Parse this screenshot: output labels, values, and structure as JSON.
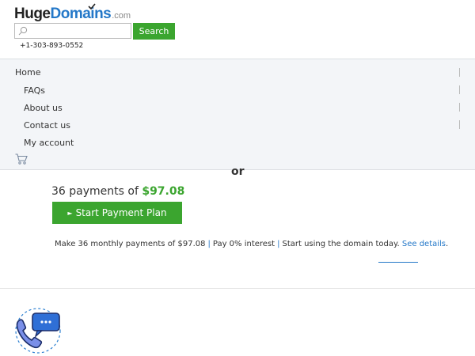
{
  "header": {
    "logo_part1": "Huge",
    "logo_part2": "Domains",
    "logo_part3": ".com",
    "search_placeholder": "",
    "search_button": "Search",
    "phone": "+1-303-893-0552"
  },
  "nav": {
    "items": [
      {
        "label": "Home"
      },
      {
        "label": "FAQs"
      },
      {
        "label": "About us"
      },
      {
        "label": "Contact us"
      },
      {
        "label": "My account"
      }
    ],
    "cart_icon": "cart-icon"
  },
  "main": {
    "or_text": "or",
    "payments_prefix": "36 payments of ",
    "payments_amount": "$97.08",
    "plan_button": "Start Payment Plan",
    "info_part1": "Make 36 monthly payments of $97.08",
    "info_sep1": "|",
    "info_part2": "Pay 0% interest",
    "info_sep2": "|",
    "info_part3": "Start using the domain today.",
    "info_link": "See details",
    "info_period": "."
  },
  "colors": {
    "accent_green": "#3ba52f",
    "accent_blue": "#2478c8",
    "nav_bg": "#f3f5f8"
  }
}
